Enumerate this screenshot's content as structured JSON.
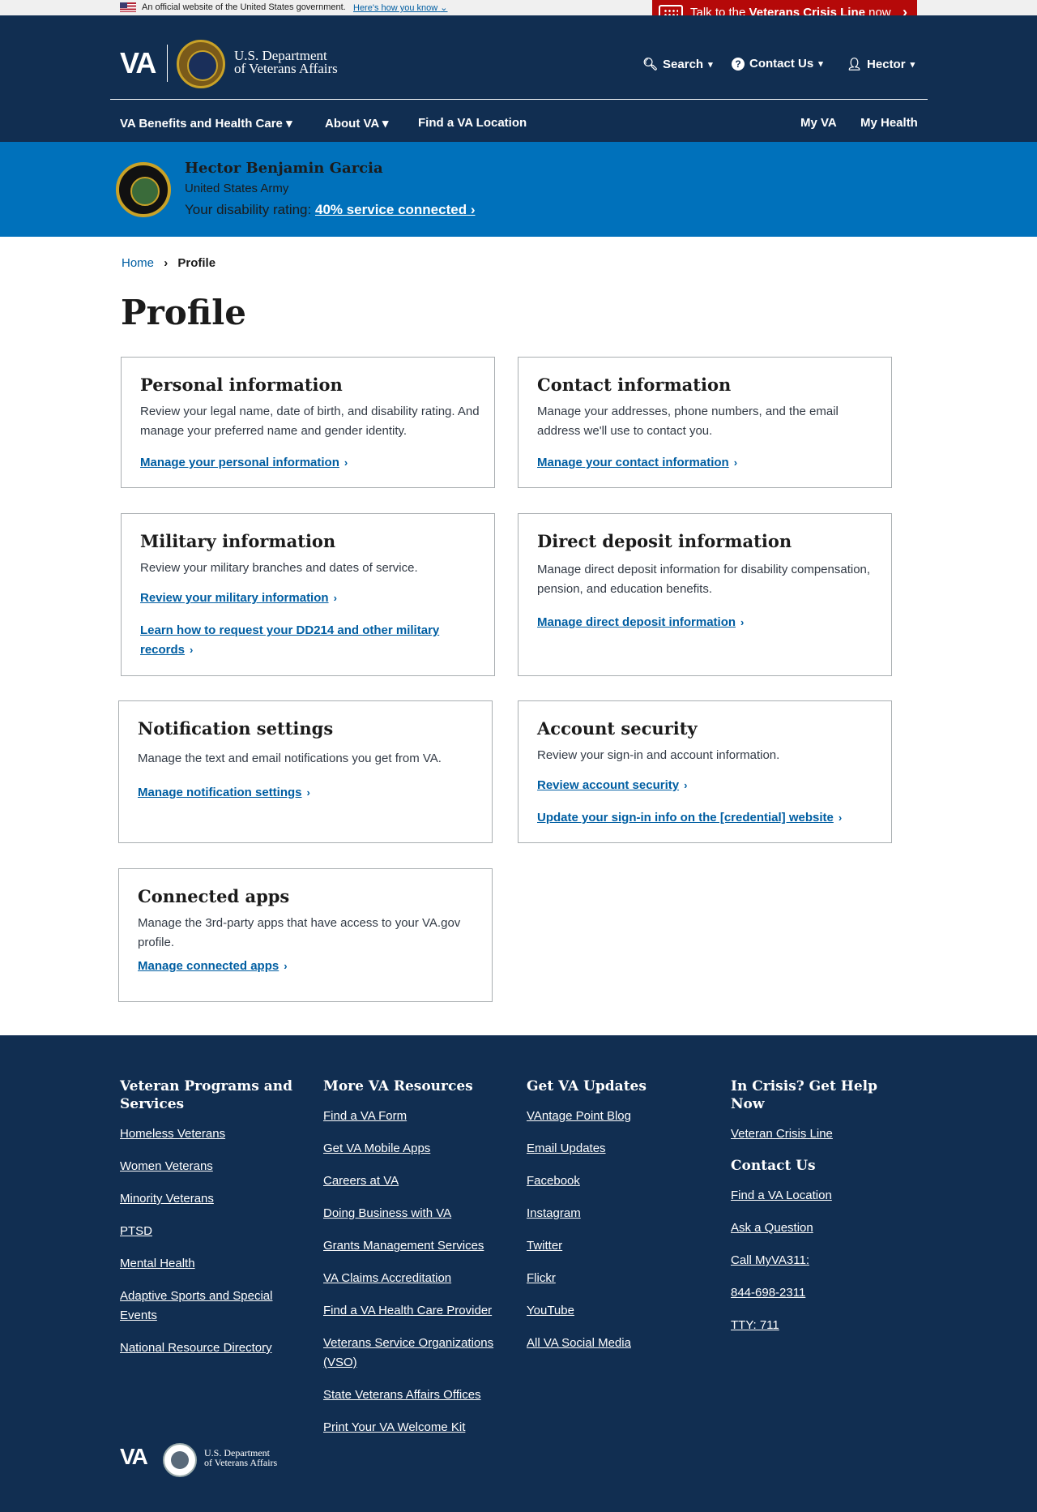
{
  "gov_banner": {
    "text": "An official website of the United States government.",
    "link": "Here's how you know"
  },
  "crisis": {
    "prefix": "Talk to the",
    "bold": "Veterans Crisis Line",
    "suffix": "now",
    "color": "#b50909"
  },
  "header": {
    "logo": "VA",
    "dept_line1": "U.S. Department",
    "dept_line2": "of Veterans Affairs",
    "search": "Search",
    "contact": "Contact Us",
    "user": "Hector",
    "nav": {
      "benefits": "VA Benefits and Health Care",
      "about": "About VA",
      "find": "Find a VA Location",
      "myva": "My VA",
      "myhealth": "My Health"
    }
  },
  "profile_banner": {
    "name": "Hector Benjamin Garcia",
    "branch": "United States Army",
    "rating_label": "Your disability rating:",
    "rating_link": "40% service connected"
  },
  "breadcrumb": {
    "home": "Home",
    "current": "Profile"
  },
  "page_title": "Profile",
  "cards": {
    "personal": {
      "title": "Personal information",
      "desc": "Review your legal name, date of birth, and disability rating. And manage your preferred name and gender identity.",
      "link": "Manage your personal information"
    },
    "contact": {
      "title": "Contact information",
      "desc": "Manage your addresses, phone numbers, and the email address we'll use to contact you.",
      "link": "Manage your contact information"
    },
    "military": {
      "title": "Military information",
      "desc": "Review your military branches and dates of service.",
      "link1": "Review your military information",
      "link2": "Learn how to request your DD214 and other military records"
    },
    "deposit": {
      "title": "Direct deposit information",
      "desc": "Manage direct deposit information for disability compensation, pension, and education benefits.",
      "link": "Manage direct deposit information"
    },
    "notifications": {
      "title": "Notification settings",
      "desc": "Manage the text and email notifications you get from VA.",
      "link": "Manage notification settings"
    },
    "security": {
      "title": "Account security",
      "desc": "Review your sign-in and account information.",
      "link1": "Review account security",
      "link2": "Update your sign-in info on the [credential] website"
    },
    "apps": {
      "title": "Connected apps",
      "desc": "Manage the 3rd-party apps that have access to your VA.gov profile.",
      "link": "Manage connected apps"
    }
  },
  "footer": {
    "col1": {
      "title": "Veteran Programs and Services",
      "links": [
        "Homeless Veterans",
        "Women Veterans",
        "Minority Veterans",
        "PTSD",
        "Mental Health",
        "Adaptive Sports and Special Events",
        "National Resource Directory"
      ]
    },
    "col2": {
      "title": "More VA Resources",
      "links": [
        "Find a VA Form",
        "Get VA Mobile Apps",
        "Careers at VA",
        "Doing Business with VA",
        "Grants Management Services",
        "VA Claims Accreditation",
        "Find a VA Health Care Provider",
        "Veterans Service Organizations (VSO)",
        "State Veterans Affairs Offices",
        "Print Your VA Welcome Kit"
      ]
    },
    "col3": {
      "title": "Get VA Updates",
      "links": [
        "VAntage Point Blog",
        "Email Updates",
        "Facebook",
        "Instagram",
        "Twitter",
        "Flickr",
        "YouTube",
        "All VA Social Media"
      ]
    },
    "col4": {
      "title": "In Crisis? Get Help Now",
      "crisis_link": "Veteran Crisis Line",
      "contact_title": "Contact Us",
      "links": [
        "Find a VA Location",
        "Ask a Question",
        "Call MyVA311:",
        "844-698-2311",
        "TTY: 711"
      ]
    },
    "logo": "VA",
    "dept_line1": "U.S. Department",
    "dept_line2": "of Veterans Affairs"
  },
  "colors": {
    "navy": "#112e51",
    "banner_blue": "#0071bb",
    "link": "#005ea2"
  }
}
